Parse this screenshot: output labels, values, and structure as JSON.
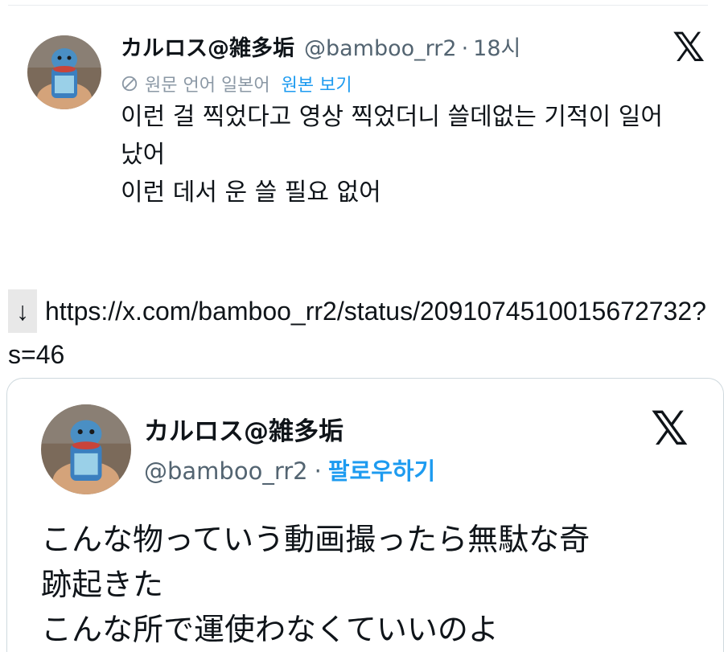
{
  "tweet": {
    "author": "カルロス@雑多垢",
    "handle": "@bamboo_rr2",
    "separator": "·",
    "time": "18시",
    "x_logo": "𝕏",
    "translate_note": "원문 언어 일본어",
    "show_original": "원본 보기",
    "body_lines": [
      "이런 걸 찍었다고 영상 찍었더니 쓸데없는 기적이 일어",
      "났어",
      "이런 데서 운 쓸 필요 없어"
    ]
  },
  "link": {
    "arrow": "↓",
    "url": "https://x.com/bamboo_rr2/status/2091074510015672732?s=46"
  },
  "embed": {
    "author": "カルロス@雑多垢",
    "handle": "@bamboo_rr2",
    "separator": "·",
    "follow": "팔로우하기",
    "x_logo": "𝕏",
    "body_lines": [
      "こんな物っていう動画撮ったら無駄な奇",
      "跡起きた",
      "こんな所で運使わなくていいのよ"
    ]
  },
  "colors": {
    "link_blue": "#1d9bf0",
    "secondary_text": "#536471",
    "primary_text": "#0f1419"
  },
  "icons": {
    "translate": "globe-icon",
    "avatar": "figure-avatar"
  }
}
